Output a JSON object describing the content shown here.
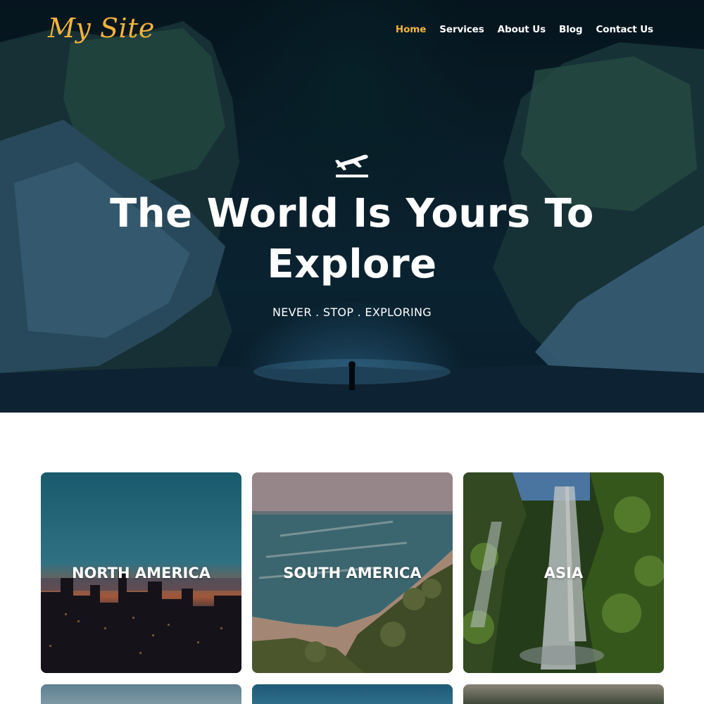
{
  "header": {
    "logo": "My Site",
    "nav": [
      {
        "label": "Home",
        "active": true
      },
      {
        "label": "Services",
        "active": false
      },
      {
        "label": "About Us",
        "active": false
      },
      {
        "label": "Blog",
        "active": false
      },
      {
        "label": "Contact Us",
        "active": false
      }
    ]
  },
  "hero": {
    "icon": "airplane-takeoff-icon",
    "title": "The World Is Yours To Explore",
    "subtitle": "NEVER . STOP . EXPLORING"
  },
  "destinations": [
    {
      "label": "NORTH AMERICA"
    },
    {
      "label": "SOUTH AMERICA"
    },
    {
      "label": "ASIA"
    }
  ],
  "colors": {
    "accent": "#f2b33d",
    "hero_bg": "#0b2430",
    "text_light": "#ffffff"
  }
}
